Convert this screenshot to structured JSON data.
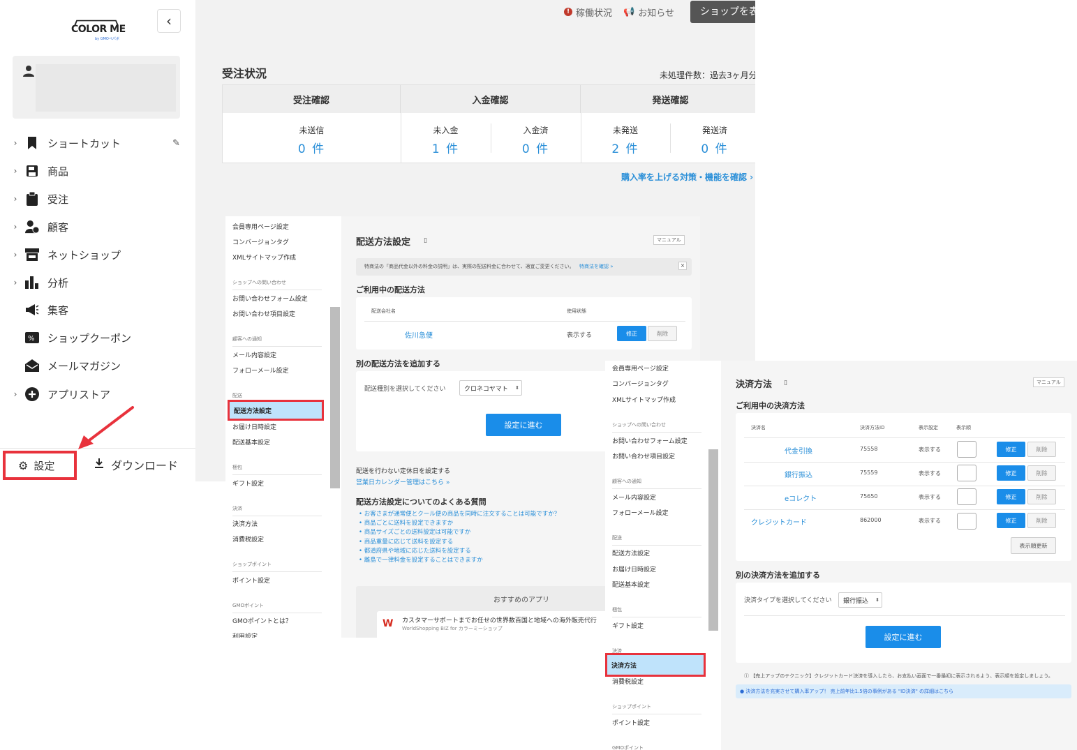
{
  "sidebar": {
    "logo": {
      "word": "COLOR ME",
      "sub": "by GMOペパボ"
    },
    "nav": [
      {
        "label": "ショートカット",
        "icon": "bookmark-icon",
        "chevron": true,
        "editable": true
      },
      {
        "label": "商品",
        "icon": "product-icon",
        "chevron": true
      },
      {
        "label": "受注",
        "icon": "clipboard-icon",
        "chevron": true
      },
      {
        "label": "顧客",
        "icon": "customer-icon",
        "chevron": true
      },
      {
        "label": "ネットショップ",
        "icon": "shop-icon",
        "chevron": true
      },
      {
        "label": "分析",
        "icon": "bar-chart-icon",
        "chevron": true
      },
      {
        "label": "集客",
        "icon": "megaphone-icon",
        "chevron": false
      },
      {
        "label": "ショップクーポン",
        "icon": "coupon-icon",
        "chevron": false
      },
      {
        "label": "メールマガジン",
        "icon": "mail-icon",
        "chevron": false
      },
      {
        "label": "アプリストア",
        "icon": "plus-circle-icon",
        "chevron": true
      }
    ],
    "settings_label": "設定",
    "download_label": "ダウンロード"
  },
  "header": {
    "status_label": "稼働状況",
    "notice_label": "お知らせ",
    "shop_button": "ショップを表"
  },
  "orders": {
    "title": "受注状況",
    "note": "未処理件数：過去3ヶ月分",
    "groups": [
      {
        "title": "受注確認",
        "cells": [
          {
            "label": "未送信",
            "value": "0 件"
          }
        ]
      },
      {
        "title": "入金確認",
        "cells": [
          {
            "label": "未入金",
            "value": "1 件"
          },
          {
            "label": "入金済",
            "value": "0 件"
          }
        ]
      },
      {
        "title": "発送確認",
        "cells": [
          {
            "label": "未発送",
            "value": "2 件"
          },
          {
            "label": "発送済",
            "value": "0 件"
          }
        ]
      }
    ],
    "improve_link": "購入率を上げる対策・機能を確認 ›"
  },
  "shipping": {
    "menu": {
      "items_top": [
        "会員専用ページ設定",
        "コンバージョンタグ",
        "XMLサイトマップ作成"
      ],
      "sec_contact": "ショップへの問い合わせ",
      "contact_items": [
        "お問い合わせフォーム設定",
        "お問い合わせ項目設定"
      ],
      "sec_notify": "顧客への通知",
      "notify_items": [
        "メール内容設定",
        "フォローメール設定"
      ],
      "sec_delivery": "配送",
      "delivery_items": [
        "配送方法設定",
        "お届け日時設定",
        "配送基本設定"
      ],
      "sec_wrap": "梱包",
      "wrap_items": [
        "ギフト設定"
      ],
      "sec_payment": "決済",
      "payment_items": [
        "決済方法",
        "消費税設定"
      ],
      "sec_point": "ショップポイント",
      "point_items": [
        "ポイント設定"
      ],
      "sec_gmo": "GMOポイント",
      "gmo_items": [
        "GMOポイントとは？",
        "利用設定"
      ]
    },
    "title": "配送方法設定",
    "manual": "マニュアル",
    "notice": "特商法の「商品代金以外の料金の説明」は、実際の配送料金に合わせて、適宜ご変更ください。",
    "notice_link": "特商法を確認 »",
    "in_use_title": "ご利用中の配送方法",
    "col_company": "配送会社名",
    "col_status": "使用状態",
    "row": {
      "name": "佐川急便",
      "status": "表示する",
      "edit": "修正",
      "delete": "削除"
    },
    "add_title": "別の配送方法を追加する",
    "select_label": "配送種別を選択してください",
    "select_value": "クロネコヤマト",
    "proceed": "設定に進む",
    "holiday_title": "配送を行わない定休日を設定する",
    "holiday_link": "営業日カレンダー管理はこちら »",
    "faq_title": "配送方法設定についてのよくある質問",
    "faq": [
      "お客さまが通常便とクール便の商品を同時に注文することは可能ですか？",
      "商品ごとに送料を設定できますか",
      "商品サイズごとの送料設定は可能ですか",
      "商品重量に応じて送料を設定する",
      "都道府県や地域に応じた送料を設定する",
      "離島で一律料金を設定することはできますか"
    ],
    "apps_title": "おすすめのアプリ",
    "app_name": "カスタマーサポートまでお任せの世界数百国と地域への海外販売代行",
    "app_sub": "WorldShopping BIZ for カラーミーショップ"
  },
  "payment": {
    "title": "決済方法",
    "manual": "マニュアル",
    "in_use_title": "ご利用中の決済方法",
    "cols": [
      "決済名",
      "決済方法ID",
      "表示設定",
      "表示順"
    ],
    "rows": [
      {
        "name": "代金引換",
        "id": "75558",
        "status": "表示する"
      },
      {
        "name": "銀行振込",
        "id": "75559",
        "status": "表示する"
      },
      {
        "name": "eコレクト",
        "id": "75650",
        "status": "表示する"
      },
      {
        "name": "クレジットカード",
        "id": "862000",
        "status": "表示する"
      }
    ],
    "edit": "修正",
    "delete": "削除",
    "update_order": "表示順更新",
    "add_title": "別の決済方法を追加する",
    "select_label": "決済タイプを選択してください",
    "select_value": "銀行振込",
    "proceed": "設定に進む",
    "tip": "【売上アップのテクニック】クレジットカード決済を導入したら、お支払い画面で一番最初に表示されるよう、表示順を設定しましょう。",
    "info": "決済方法を充実させて購入率アップ！ 売上前年比1.5倍の事例がある \"ID決済\" の詳細はこちら"
  },
  "colors": {
    "accent": "#2a8fd8",
    "highlight_red": "#e8323c",
    "button_blue": "#1a8de9"
  }
}
